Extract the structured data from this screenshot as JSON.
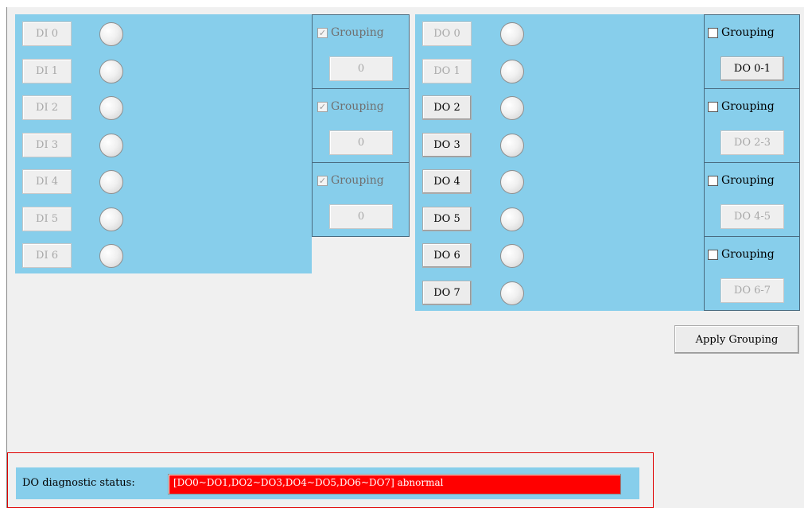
{
  "di_section": {
    "channels": [
      {
        "label": "DI 0",
        "enabled": false
      },
      {
        "label": "DI 1",
        "enabled": false
      },
      {
        "label": "DI 2",
        "enabled": false
      },
      {
        "label": "DI 3",
        "enabled": false
      },
      {
        "label": "DI 4",
        "enabled": false
      },
      {
        "label": "DI 5",
        "enabled": false
      },
      {
        "label": "DI 6",
        "enabled": false
      }
    ],
    "groups": [
      {
        "checkbox_label": "Grouping",
        "checked": true,
        "disabled": true,
        "button_label": "0",
        "button_enabled": false
      },
      {
        "checkbox_label": "Grouping",
        "checked": true,
        "disabled": true,
        "button_label": "0",
        "button_enabled": false
      },
      {
        "checkbox_label": "Grouping",
        "checked": true,
        "disabled": true,
        "button_label": "0",
        "button_enabled": false
      }
    ]
  },
  "do_section": {
    "channels": [
      {
        "label": "DO 0",
        "enabled": false
      },
      {
        "label": "DO 1",
        "enabled": false
      },
      {
        "label": "DO 2",
        "enabled": true
      },
      {
        "label": "DO 3",
        "enabled": true
      },
      {
        "label": "DO 4",
        "enabled": true
      },
      {
        "label": "DO 5",
        "enabled": true
      },
      {
        "label": "DO 6",
        "enabled": true
      },
      {
        "label": "DO 7",
        "enabled": true
      }
    ],
    "groups": [
      {
        "checkbox_label": "Grouping",
        "checked": false,
        "disabled": false,
        "button_label": "DO 0-1",
        "button_enabled": true
      },
      {
        "checkbox_label": "Grouping",
        "checked": false,
        "disabled": false,
        "button_label": "DO 2-3",
        "button_enabled": false
      },
      {
        "checkbox_label": "Grouping",
        "checked": false,
        "disabled": false,
        "button_label": "DO 4-5",
        "button_enabled": false
      },
      {
        "checkbox_label": "Grouping",
        "checked": false,
        "disabled": false,
        "button_label": "DO 6-7",
        "button_enabled": false
      }
    ]
  },
  "apply_grouping_label": "Apply Grouping",
  "diagnostic": {
    "label": "DO diagnostic status:",
    "value": "[DO0~DO1,DO2~DO3,DO4~DO5,DO6~DO7] abnormal",
    "status_color": "#ff0000"
  },
  "colors": {
    "panel_blue": "#87ceeb",
    "window_background": "#f0f0f0",
    "diagnostic_frame": "#e00000"
  }
}
